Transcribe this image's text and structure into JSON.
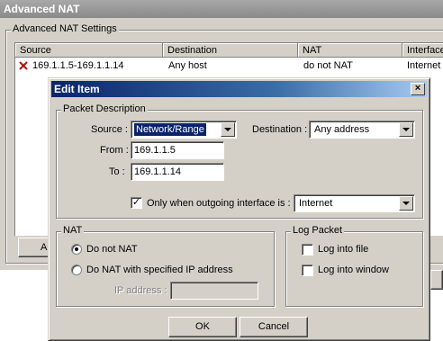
{
  "main_window": {
    "title": "Advanced NAT",
    "group_title": "Advanced NAT Settings",
    "columns": [
      "Source",
      "Destination",
      "NAT",
      "Interface"
    ],
    "rows": [
      {
        "icon": "red-x-icon",
        "source": "169.1.1.5-169.1.1.14",
        "destination": "Any host",
        "nat": "do not NAT",
        "interface": "Internet"
      }
    ],
    "add_button_partial": "A"
  },
  "dialog": {
    "title": "Edit Item",
    "close_label": "×",
    "packet_description": {
      "group_title": "Packet Description",
      "source_label": "Source :",
      "source_value": "Network/Range",
      "destination_label": "Destination :",
      "destination_value": "Any address",
      "from_label": "From :",
      "from_value": "169.1.1.5",
      "to_label": "To :",
      "to_value": "169.1.1.14",
      "outgoing_checked": true,
      "outgoing_label": "Only when outgoing interface is :",
      "outgoing_value": "Internet"
    },
    "nat": {
      "group_title": "NAT",
      "option_do_not": "Do not NAT",
      "option_do_nat": "Do NAT with specified IP address",
      "selected": "Do not NAT",
      "ip_label": "IP address :",
      "ip_value": ""
    },
    "log": {
      "group_title": "Log Packet",
      "log_file_label": "Log into file",
      "log_file_checked": false,
      "log_window_label": "Log into window",
      "log_window_checked": false
    },
    "ok_label": "OK",
    "cancel_label": "Cancel"
  },
  "colors": {
    "title_active": "#0a246a",
    "title_inactive": "#8a8a8a",
    "face": "#d4d0c8",
    "delete_icon": "#b01818"
  }
}
